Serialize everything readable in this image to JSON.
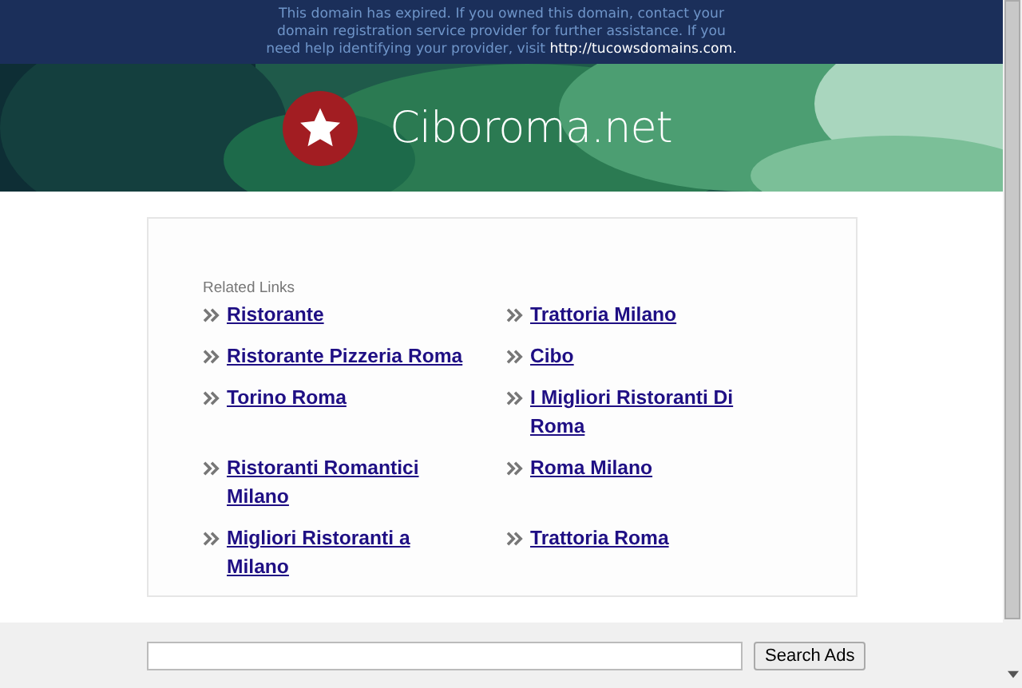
{
  "notice": {
    "text": "This domain has expired. If you owned this domain, contact your domain registration service provider for further assistance. If you need help identifying your provider, visit",
    "link": "http://tucowsdomains.com."
  },
  "header": {
    "title": "Ciboroma.net"
  },
  "related": {
    "heading": "Related Links",
    "links": [
      {
        "text": "Ristorante"
      },
      {
        "text": "Trattoria Milano"
      },
      {
        "text": "Ristorante Pizzeria Roma"
      },
      {
        "text": "Cibo"
      },
      {
        "text": "Torino Roma"
      },
      {
        "text": "I Migliori Ristoranti Di Roma"
      },
      {
        "text": "Ristoranti Romantici Milano"
      },
      {
        "text": "Roma Milano"
      },
      {
        "text": "Migliori Ristoranti a Milano"
      },
      {
        "text": "Trattoria Roma"
      }
    ]
  },
  "search": {
    "button": "Search Ads"
  }
}
